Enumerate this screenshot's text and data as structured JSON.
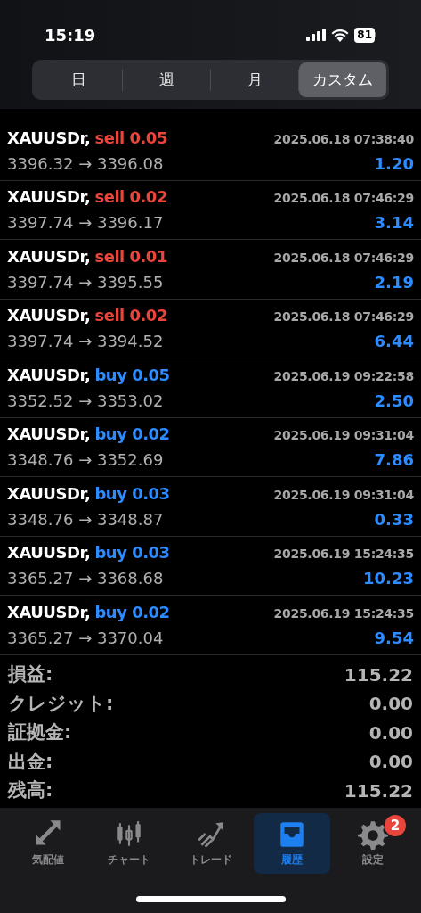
{
  "status_bar": {
    "time": "15:19",
    "battery": "81"
  },
  "segments": [
    {
      "label": "日",
      "selected": false
    },
    {
      "label": "週",
      "selected": false
    },
    {
      "label": "月",
      "selected": false
    },
    {
      "label": "カスタム",
      "selected": true
    }
  ],
  "deals": [
    {
      "symbol": "XAUUSDr,",
      "kind": "sell",
      "volume": "sell 0.05",
      "time": "2025.06.18 07:38:40",
      "prices": "3396.32 → 3396.08",
      "profit": "1.20"
    },
    {
      "symbol": "XAUUSDr,",
      "kind": "sell",
      "volume": "sell 0.02",
      "time": "2025.06.18 07:46:29",
      "prices": "3397.74 → 3396.17",
      "profit": "3.14"
    },
    {
      "symbol": "XAUUSDr,",
      "kind": "sell",
      "volume": "sell 0.01",
      "time": "2025.06.18 07:46:29",
      "prices": "3397.74 → 3395.55",
      "profit": "2.19"
    },
    {
      "symbol": "XAUUSDr,",
      "kind": "sell",
      "volume": "sell 0.02",
      "time": "2025.06.18 07:46:29",
      "prices": "3397.74 → 3394.52",
      "profit": "6.44"
    },
    {
      "symbol": "XAUUSDr,",
      "kind": "buy",
      "volume": "buy 0.05",
      "time": "2025.06.19 09:22:58",
      "prices": "3352.52 → 3353.02",
      "profit": "2.50"
    },
    {
      "symbol": "XAUUSDr,",
      "kind": "buy",
      "volume": "buy 0.02",
      "time": "2025.06.19 09:31:04",
      "prices": "3348.76 → 3352.69",
      "profit": "7.86"
    },
    {
      "symbol": "XAUUSDr,",
      "kind": "buy",
      "volume": "buy 0.03",
      "time": "2025.06.19 09:31:04",
      "prices": "3348.76 → 3348.87",
      "profit": "0.33"
    },
    {
      "symbol": "XAUUSDr,",
      "kind": "buy",
      "volume": "buy 0.03",
      "time": "2025.06.19 15:24:35",
      "prices": "3365.27 → 3368.68",
      "profit": "10.23"
    },
    {
      "symbol": "XAUUSDr,",
      "kind": "buy",
      "volume": "buy 0.02",
      "time": "2025.06.19 15:24:35",
      "prices": "3365.27 → 3370.04",
      "profit": "9.54"
    }
  ],
  "summary": [
    {
      "label": "損益:",
      "value": "115.22"
    },
    {
      "label": "クレジット:",
      "value": "0.00"
    },
    {
      "label": "証拠金:",
      "value": "0.00"
    },
    {
      "label": "出金:",
      "value": "0.00"
    },
    {
      "label": "残高:",
      "value": "115.22"
    }
  ],
  "tab_bar": [
    {
      "kind": "quotes",
      "label": "気配値",
      "selected": false
    },
    {
      "kind": "chart",
      "label": "チャート",
      "selected": false
    },
    {
      "kind": "trade",
      "label": "トレード",
      "selected": false
    },
    {
      "kind": "history",
      "label": "履歴",
      "selected": true
    },
    {
      "kind": "settings",
      "label": "設定",
      "selected": false,
      "badge": "2"
    }
  ]
}
